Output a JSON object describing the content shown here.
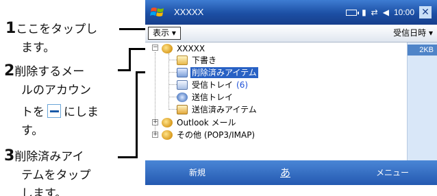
{
  "callouts": {
    "step1": {
      "num": "1",
      "text_line1": "ここをタップし",
      "text_line2": "ます。"
    },
    "step2": {
      "num": "2",
      "text_line1": "削除するメー",
      "text_line2": "ルのアカウン",
      "text_line3_pre": "トを",
      "text_line3_post": "にしま",
      "text_line4": "す。"
    },
    "step3": {
      "num": "3",
      "text_line1": "削除済みアイ",
      "text_line2": "テムをタップ",
      "text_line3": "します。"
    }
  },
  "titlebar": {
    "app_title": "XXXXX",
    "clock": "10:00",
    "close_label": "✕",
    "icons": [
      "start-logo-icon",
      "battery-icon",
      "signal-icon",
      "connectivity-icon",
      "volume-icon"
    ]
  },
  "menubar": {
    "folder_label": "表示 ▾",
    "sort_label": "受信日時 ▾"
  },
  "size_column": {
    "header": "2KB"
  },
  "tree": {
    "account": "XXXXX",
    "folders": [
      {
        "label": "下書き",
        "icon": "drafts-folder-icon"
      },
      {
        "label": "削除済みアイテム",
        "icon": "deleted-items-folder-icon",
        "selected": true
      },
      {
        "label": "受信トレイ",
        "unread": "(6)",
        "icon": "inbox-folder-icon"
      },
      {
        "label": "送信トレイ",
        "icon": "outbox-folder-icon"
      },
      {
        "label": "送信済みアイテム",
        "icon": "sent-items-folder-icon"
      }
    ],
    "other_accounts": [
      {
        "label": "Outlook メール"
      },
      {
        "label": "その他 (POP3/IMAP)"
      }
    ]
  },
  "bottombar": {
    "left_softkey": "新規",
    "ime": "あ",
    "right_softkey": "メニュー"
  }
}
